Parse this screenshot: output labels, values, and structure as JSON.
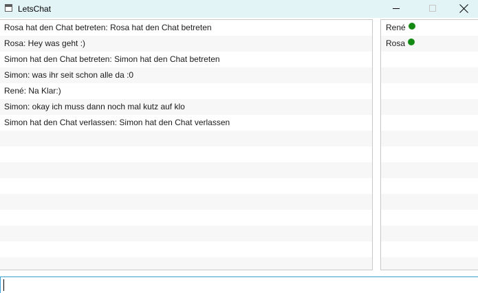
{
  "window": {
    "title": "LetsChat"
  },
  "messages": [
    "Rosa hat den Chat betreten: Rosa hat den Chat betreten",
    "Rosa: Hey was geht :)",
    "Simon hat den Chat betreten: Simon hat den Chat betreten",
    "Simon: was ihr seit schon alle da :0",
    "René: Na Klar:)",
    "Simon: okay ich muss dann noch mal kutz auf klo",
    "Simon hat den Chat verlassen: Simon hat den Chat verlassen"
  ],
  "users": [
    {
      "name": "René",
      "status_color": "#148a14"
    },
    {
      "name": "Rosa",
      "status_color": "#148a14"
    }
  ],
  "input": {
    "value": ""
  },
  "icons": {
    "app": "window-icon",
    "minimize": "minimize-icon",
    "maximize": "maximize-icon",
    "close": "close-icon",
    "status": "online-status-icon"
  }
}
